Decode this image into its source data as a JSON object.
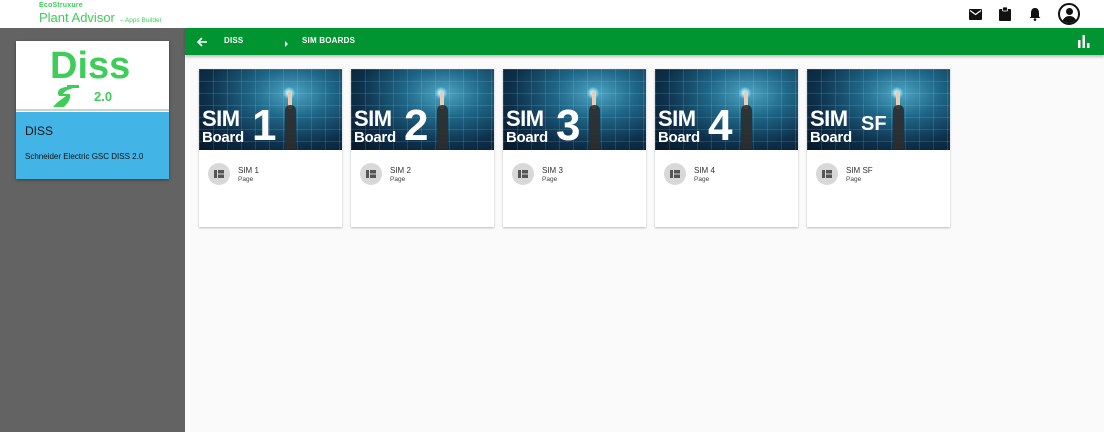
{
  "header": {
    "brand_top": "EcoStruxure",
    "brand_name": "Plant Advisor",
    "brand_sub": "– Apps Builder",
    "icons": [
      "mail-icon",
      "clipboard-icon",
      "bell-icon",
      "account-icon"
    ]
  },
  "sidebar": {
    "app": {
      "logo_text": "Diss",
      "logo_version": "2.0",
      "title": "DISS",
      "description": "Schneider Electric GSC DISS 2.0"
    }
  },
  "breadcrumb": {
    "items": [
      {
        "label": "DISS"
      },
      {
        "label": "SIM BOARDS"
      }
    ]
  },
  "cards": [
    {
      "image_sim": "SIM",
      "image_board": "Board",
      "image_number": "1",
      "title": "SIM 1",
      "subtitle": "Page"
    },
    {
      "image_sim": "SIM",
      "image_board": "Board",
      "image_number": "2",
      "title": "SIM 2",
      "subtitle": "Page"
    },
    {
      "image_sim": "SIM",
      "image_board": "Board",
      "image_number": "3",
      "title": "SIM 3",
      "subtitle": "Page"
    },
    {
      "image_sim": "SIM",
      "image_board": "Board",
      "image_number": "4",
      "title": "SIM 4",
      "subtitle": "Page"
    },
    {
      "image_sim": "SIM",
      "image_board": "Board",
      "image_number": "SF",
      "title": "SIM SF",
      "subtitle": "Page"
    }
  ],
  "colors": {
    "brand_green": "#3dcd58",
    "nav_green": "#009530",
    "app_card_blue": "#42b4e6",
    "sidebar_gray": "#636363"
  }
}
